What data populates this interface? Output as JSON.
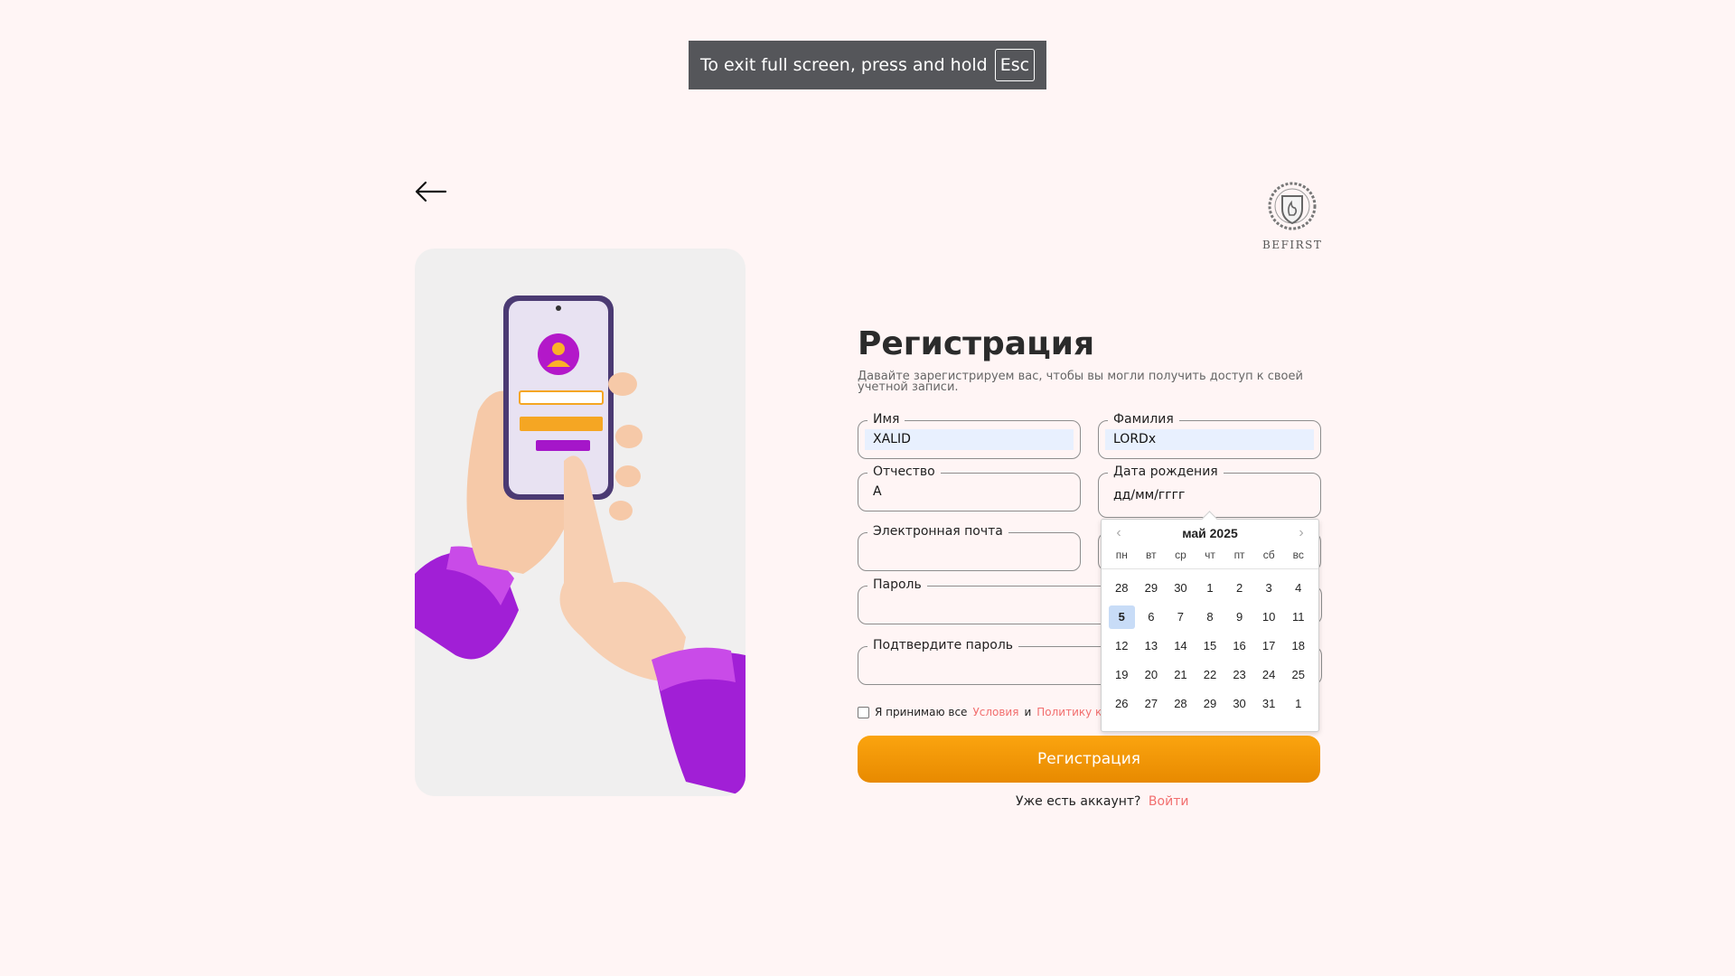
{
  "fullscreen_banner": {
    "text": "To exit full screen, press and hold",
    "key": "Esc"
  },
  "logo": {
    "brand": "BEFIRST"
  },
  "form": {
    "title": "Регистрация",
    "subtitle": "Давайте зарегистрируем вас, чтобы вы могли получить доступ к своей учетной записи.",
    "first_name": {
      "label": "Имя",
      "value": "XALID"
    },
    "last_name": {
      "label": "Фамилия",
      "value": "LORDx"
    },
    "middle_name": {
      "label": "Отчество",
      "value": "A"
    },
    "birth_date": {
      "label": "Дата рождения",
      "placeholder": "дд/мм/гггг"
    },
    "email": {
      "label": "Электронная почта",
      "value": ""
    },
    "phone": {
      "label": "",
      "value": ""
    },
    "password": {
      "label": "Пароль",
      "value": ""
    },
    "confirm_password": {
      "label": "Подтвердите пароль",
      "value": ""
    },
    "terms": {
      "prefix": "Я принимаю все",
      "terms_link": "Условия",
      "and": "и",
      "privacy_link": "Политику конфи"
    },
    "submit_label": "Регистрация",
    "login_prompt": "Уже есть аккаунт?",
    "login_link": "Войти"
  },
  "calendar": {
    "month": "май 2025",
    "weekdays": [
      "пн",
      "вт",
      "ср",
      "чт",
      "пт",
      "сб",
      "вс"
    ],
    "selected": "5",
    "weeks": [
      [
        "28",
        "29",
        "30",
        "1",
        "2",
        "3",
        "4"
      ],
      [
        "5",
        "6",
        "7",
        "8",
        "9",
        "10",
        "11"
      ],
      [
        "12",
        "13",
        "14",
        "15",
        "16",
        "17",
        "18"
      ],
      [
        "19",
        "20",
        "21",
        "22",
        "23",
        "24",
        "25"
      ],
      [
        "26",
        "27",
        "28",
        "29",
        "30",
        "31",
        "1"
      ]
    ]
  },
  "colors": {
    "background": "#fff5f5",
    "accent": "#f59a0b",
    "link": "#f26f6f",
    "selected_day": "#c8dcf7"
  }
}
